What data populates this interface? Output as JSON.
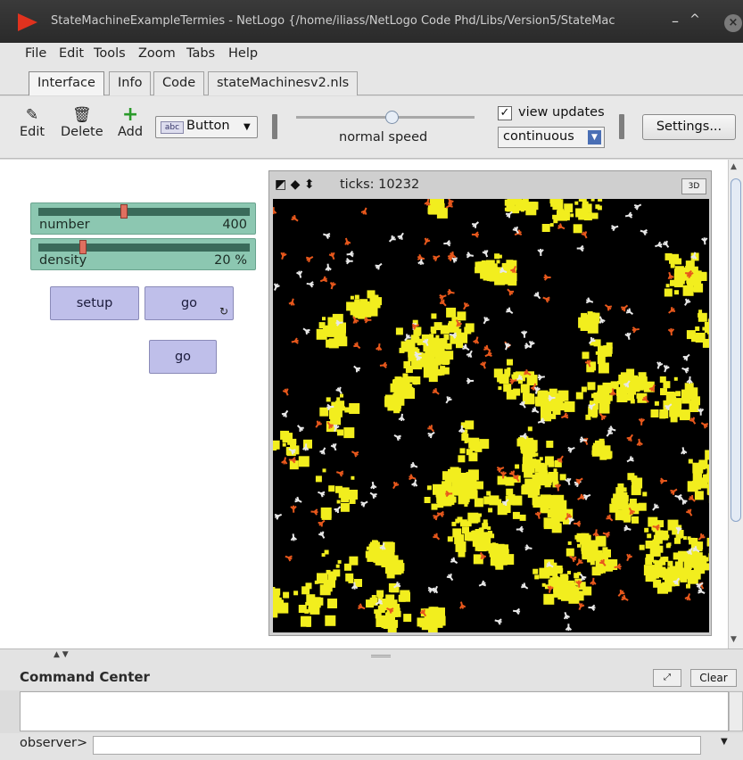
{
  "window": {
    "title": "StateMachineExampleTermies - NetLogo {/home/iliass/NetLogo Code Phd/Libs/Version5/StateMac",
    "controls": {
      "minimize": "–",
      "maximize": "^",
      "close": "×"
    }
  },
  "menu": [
    "File",
    "Edit",
    "Tools",
    "Zoom",
    "Tabs",
    "Help"
  ],
  "tabs": [
    {
      "label": "Interface",
      "active": true
    },
    {
      "label": "Info"
    },
    {
      "label": "Code"
    },
    {
      "label": "stateMachinesv2.nls"
    }
  ],
  "toolbar": {
    "edit_label": "Edit",
    "delete_label": "Delete",
    "add_label": "Add",
    "widget_type": "Button",
    "widget_type_icon": "abc",
    "speed_label": "normal speed",
    "speed_value": 0.5,
    "view_updates_label": "view updates",
    "view_updates_checked": true,
    "update_mode": "continuous",
    "settings_label": "Settings..."
  },
  "sliders": [
    {
      "name": "number",
      "value": "400",
      "level": 0.4
    },
    {
      "name": "density",
      "value": "20 %",
      "level": 0.2
    }
  ],
  "buttons": {
    "setup": "setup",
    "go_forever": "go",
    "go_once": "go"
  },
  "view": {
    "ticks_label": "ticks: 10232",
    "btn_3d": "3D",
    "colors": {
      "background": "#000000",
      "patch": "#f2ee1e",
      "termite_carrying": "#e8581c",
      "termite": "#e8e8e8"
    }
  },
  "command_center": {
    "title": "Command Center",
    "clear_label": "Clear",
    "observer_label": "observer>",
    "input_value": ""
  }
}
